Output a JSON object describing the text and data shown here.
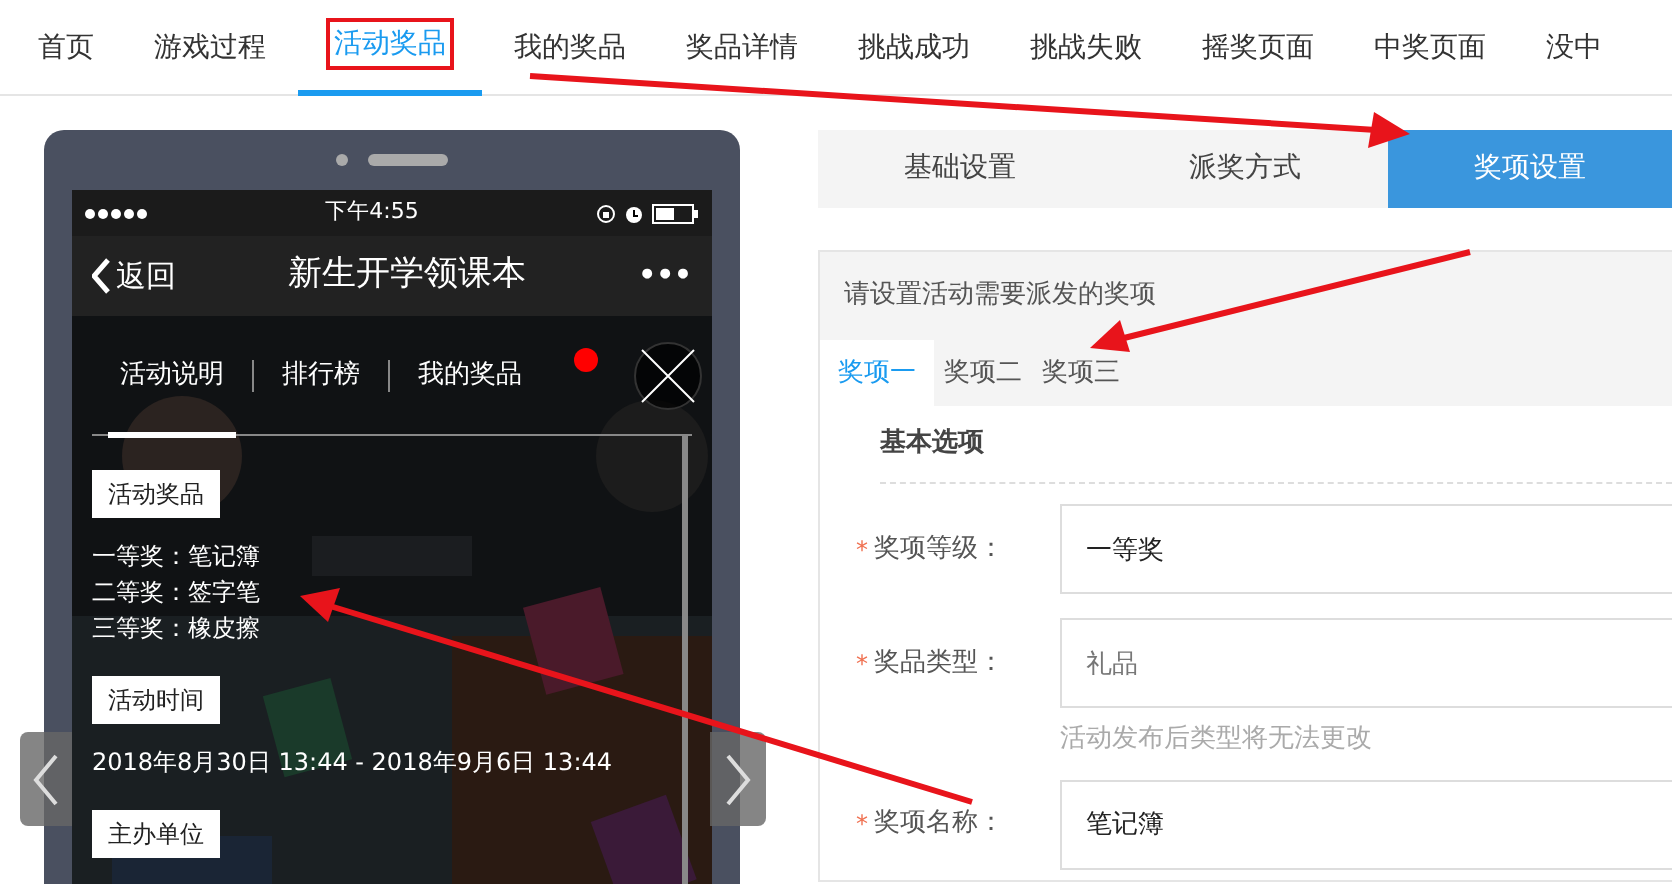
{
  "nav_tabs": [
    {
      "label": "首页",
      "selected": false
    },
    {
      "label": "游戏过程",
      "selected": false
    },
    {
      "label": "活动奖品",
      "selected": true
    },
    {
      "label": "我的奖品",
      "selected": false
    },
    {
      "label": "奖品详情",
      "selected": false
    },
    {
      "label": "挑战成功",
      "selected": false
    },
    {
      "label": "挑战失败",
      "selected": false
    },
    {
      "label": "摇奖页面",
      "selected": false
    },
    {
      "label": "中奖页面",
      "selected": false
    },
    {
      "label": "没中",
      "selected": false
    }
  ],
  "phone": {
    "status_bar": {
      "time": "下午4:55"
    },
    "nav_bar": {
      "back": "返回",
      "title": "新生开学领课本",
      "more": "•••"
    },
    "tabs": [
      {
        "label": "活动说明",
        "selected": true
      },
      {
        "label": "排行榜",
        "selected": false
      },
      {
        "label": "我的奖品",
        "selected": false,
        "badge": true
      }
    ],
    "sections": [
      {
        "heading": "活动奖品",
        "lines": [
          "一等奖：笔记簿",
          "二等奖：签字笔",
          "三等奖：橡皮擦"
        ]
      },
      {
        "heading": "活动时间",
        "lines": [
          "2018年8月30日 13:44 - 2018年9月6日 13:44"
        ]
      },
      {
        "heading": "主办单位"
      }
    ]
  },
  "step_tabs": [
    {
      "label": "基础设置",
      "selected": false
    },
    {
      "label": "派奖方式",
      "selected": false
    },
    {
      "label": "奖项设置",
      "selected": true
    }
  ],
  "panel": {
    "header": "请设置活动需要派发的奖项",
    "prize_tabs": [
      {
        "label": "奖项一",
        "selected": true
      },
      {
        "label": "奖项二",
        "selected": false
      },
      {
        "label": "奖项三",
        "selected": false
      }
    ],
    "section_title": "基本选项",
    "fields": [
      {
        "label": "奖项等级：",
        "required_mark": "*",
        "value": "一等奖",
        "disabled": false
      },
      {
        "label": "奖品类型：",
        "required_mark": "*",
        "value": "礼品",
        "disabled": true,
        "hint": "活动发布后类型将无法更改"
      },
      {
        "label": "奖项名称：",
        "required_mark": "*",
        "value": "笔记簿",
        "disabled": false
      }
    ]
  }
}
